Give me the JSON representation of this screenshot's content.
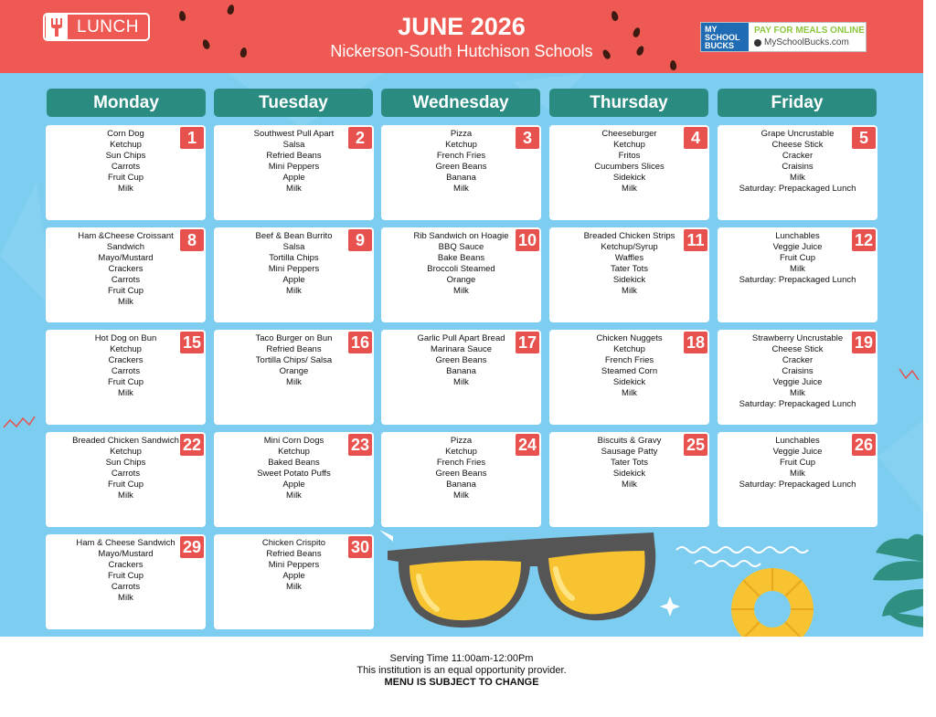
{
  "header": {
    "badge_label": "LUNCH",
    "title": "JUNE 2026",
    "subtitle": "Nickerson-South Hutchison Schools",
    "msb_logo_lines": [
      "MY",
      "SCHOOL",
      "BUCKS"
    ],
    "msb_pay": "PAY FOR MEALS ONLINE",
    "msb_url": "MySchoolBucks.com"
  },
  "colors": {
    "header_bg": "#ee5a53",
    "body_bg": "#7ccdf0",
    "day_header_bg": "#2a8b80",
    "date_badge_bg": "#e8524e",
    "msb_blue": "#1f6cb4",
    "msb_green": "#8dc63f"
  },
  "icons": [
    "fork-icon",
    "watermelon-seed-icon",
    "sunglasses-icon",
    "pineapple-slice-icon",
    "palm-leaf-icon",
    "sparkle-icon",
    "wave-icon"
  ],
  "days": [
    "Monday",
    "Tuesday",
    "Wednesday",
    "Thursday",
    "Friday"
  ],
  "weeks": [
    [
      {
        "date": "1",
        "items": [
          "Corn Dog",
          "Ketchup",
          "Sun Chips",
          "Carrots",
          "Fruit Cup",
          "Milk"
        ]
      },
      {
        "date": "2",
        "items": [
          "Southwest Pull Apart",
          "Salsa",
          "Refried Beans",
          "Mini Peppers",
          "Apple",
          "Milk"
        ]
      },
      {
        "date": "3",
        "items": [
          "Pizza",
          "Ketchup",
          "French Fries",
          "Green Beans",
          "Banana",
          "Milk"
        ]
      },
      {
        "date": "4",
        "items": [
          "Cheeseburger",
          "Ketchup",
          "Fritos",
          "Cucumbers Slices",
          "Sidekick",
          "Milk"
        ]
      },
      {
        "date": "5",
        "items": [
          "Grape Uncrustable",
          "Cheese Stick",
          "Cracker",
          "Craisins",
          "Milk",
          "Saturday: Prepackaged Lunch"
        ]
      }
    ],
    [
      {
        "date": "8",
        "items": [
          "Ham &Cheese Croissant",
          "Sandwich",
          "Mayo/Mustard",
          "Crackers",
          "Carrots",
          "Fruit Cup",
          "Milk"
        ]
      },
      {
        "date": "9",
        "items": [
          "Beef & Bean Burrito",
          "Salsa",
          "Tortilla Chips",
          "Mini Peppers",
          "Apple",
          "Milk"
        ]
      },
      {
        "date": "10",
        "items": [
          "Rib Sandwich on Hoagie",
          "BBQ Sauce",
          "Bake Beans",
          "Broccoli Steamed",
          "Orange",
          "Milk"
        ]
      },
      {
        "date": "11",
        "items": [
          "Breaded Chicken Strips",
          "Ketchup/Syrup",
          "Waffles",
          "Tater Tots",
          "Sidekick",
          "Milk"
        ]
      },
      {
        "date": "12",
        "items": [
          "Lunchables",
          "Veggie Juice",
          "Fruit Cup",
          "Milk",
          "Saturday: Prepackaged Lunch"
        ]
      }
    ],
    [
      {
        "date": "15",
        "items": [
          "Hot Dog on Bun",
          "Ketchup",
          "Crackers",
          "Carrots",
          "Fruit Cup",
          "Milk"
        ]
      },
      {
        "date": "16",
        "items": [
          "Taco Burger on Bun",
          "Refried Beans",
          "Tortilla Chips/ Salsa",
          "Orange",
          "Milk"
        ]
      },
      {
        "date": "17",
        "items": [
          "Garlic Pull Apart Bread",
          "Marinara Sauce",
          "Green Beans",
          "Banana",
          "Milk"
        ]
      },
      {
        "date": "18",
        "items": [
          "Chicken Nuggets",
          "Ketchup",
          "French Fries",
          "Steamed Corn",
          "Sidekick",
          "Milk"
        ]
      },
      {
        "date": "19",
        "items": [
          "Strawberry Uncrustable",
          "Cheese Stick",
          "Cracker",
          "Craisins",
          "Veggie Juice",
          "Milk",
          "Saturday: Prepackaged Lunch"
        ]
      }
    ],
    [
      {
        "date": "22",
        "items": [
          "Breaded Chicken Sandwich",
          "Ketchup",
          "Sun Chips",
          "Carrots",
          "Fruit Cup",
          "Milk"
        ]
      },
      {
        "date": "23",
        "items": [
          "Mini Corn Dogs",
          "Ketchup",
          "Baked Beans",
          "Sweet Potato Puffs",
          "Apple",
          "Milk"
        ]
      },
      {
        "date": "24",
        "items": [
          "Pizza",
          "Ketchup",
          "French Fries",
          "Green Beans",
          "Banana",
          "Milk"
        ]
      },
      {
        "date": "25",
        "items": [
          "Biscuits & Gravy",
          "Sausage Patty",
          "Tater Tots",
          "Sidekick",
          "Milk"
        ]
      },
      {
        "date": "26",
        "items": [
          "Lunchables",
          "Veggie Juice",
          "Fruit Cup",
          "Milk",
          "Saturday: Prepackaged Lunch"
        ]
      }
    ],
    [
      {
        "date": "29",
        "items": [
          "Ham & Cheese Sandwich",
          "Mayo/Mustard",
          "Crackers",
          "Fruit Cup",
          "Carrots",
          "Milk"
        ]
      },
      {
        "date": "30",
        "items": [
          "Chicken Crispito",
          "Refried Beans",
          "Mini Peppers",
          "Apple",
          "Milk"
        ]
      }
    ]
  ],
  "footer": {
    "serving_time": "Serving Time 11:00am-12:00Pm",
    "equal_opportunity": "This institution is an equal opportunity provider.",
    "disclaimer": "MENU IS SUBJECT TO CHANGE"
  }
}
